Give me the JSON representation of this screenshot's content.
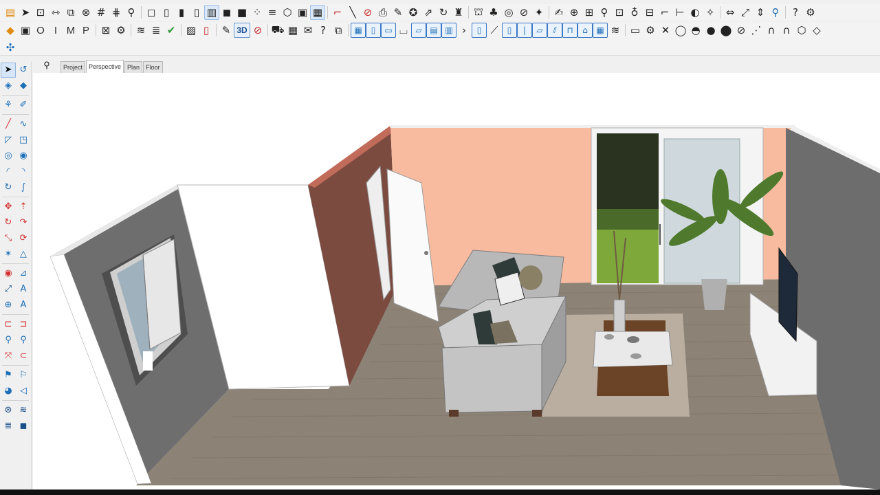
{
  "toolbar": {
    "row1": [
      {
        "name": "open-file-icon",
        "glyph": "▤",
        "cls": "orange"
      },
      {
        "name": "send-icon",
        "glyph": "➤"
      },
      {
        "name": "select-window-icon",
        "glyph": "⊡"
      },
      {
        "name": "fit-width-icon",
        "glyph": "⇿"
      },
      {
        "name": "resize-icon",
        "glyph": "⧉"
      },
      {
        "name": "link-icon",
        "glyph": "⊗"
      },
      {
        "name": "grid-icon",
        "glyph": "#"
      },
      {
        "name": "grid-off-icon",
        "glyph": "⋕"
      },
      {
        "name": "zoom-icon",
        "glyph": "⚲"
      },
      {
        "sep": true
      },
      {
        "name": "box-view-1-icon",
        "glyph": "◻"
      },
      {
        "name": "box-view-2-icon",
        "glyph": "▯"
      },
      {
        "name": "box-view-3-icon",
        "glyph": "▮"
      },
      {
        "name": "box-view-4-icon",
        "glyph": "▯"
      },
      {
        "name": "box-view-5-icon",
        "glyph": "▥",
        "cls": "active"
      },
      {
        "name": "solid-view-icon",
        "glyph": "◼"
      },
      {
        "name": "cube-icon",
        "glyph": "■"
      },
      {
        "name": "dots-icon",
        "glyph": "⁘"
      },
      {
        "name": "layers-icon",
        "glyph": "≡"
      },
      {
        "name": "hexagon-icon",
        "glyph": "⬡"
      },
      {
        "name": "frame-icon",
        "glyph": "▣"
      },
      {
        "name": "frame-active-icon",
        "glyph": "▦",
        "cls": "active"
      },
      {
        "sep": true
      },
      {
        "name": "curve-tool-icon",
        "glyph": "⌐",
        "cls": "red"
      },
      {
        "name": "pen-icon",
        "glyph": "╲"
      },
      {
        "name": "no-pen-icon",
        "glyph": "⊘",
        "cls": "red"
      },
      {
        "name": "printer-icon",
        "glyph": "⎙"
      },
      {
        "name": "brush-icon",
        "glyph": "✎"
      },
      {
        "name": "palette-icon",
        "glyph": "✪"
      },
      {
        "name": "transform-icon",
        "glyph": "⇗"
      },
      {
        "name": "rotate-icon",
        "glyph": "↻"
      },
      {
        "name": "stamp-icon",
        "glyph": "♜"
      },
      {
        "sep": true
      },
      {
        "name": "scene-icon",
        "glyph": "⛫"
      },
      {
        "name": "tree-icon",
        "glyph": "♣"
      },
      {
        "name": "target-icon",
        "glyph": "◎"
      },
      {
        "name": "no-entry-icon",
        "glyph": "⊘"
      },
      {
        "name": "magic-wand-icon",
        "glyph": "✦"
      },
      {
        "sep": true
      },
      {
        "name": "notes-icon",
        "glyph": "✍"
      },
      {
        "name": "align-icon",
        "glyph": "⊕"
      },
      {
        "name": "distribute-icon",
        "glyph": "⊞"
      },
      {
        "name": "map-pin-icon",
        "glyph": "⚲"
      },
      {
        "name": "measure-icon",
        "glyph": "⊡"
      },
      {
        "name": "lock-icon",
        "glyph": "♁"
      },
      {
        "name": "stack-icon",
        "glyph": "⊟"
      },
      {
        "name": "bracket-icon",
        "glyph": "⌐"
      },
      {
        "name": "dimension-icon",
        "glyph": "⊢"
      },
      {
        "name": "contrast-icon",
        "glyph": "◐"
      },
      {
        "name": "sparkle-icon",
        "glyph": "✧"
      },
      {
        "sep": true
      },
      {
        "name": "arrows-horizontal-icon",
        "glyph": "⇔"
      },
      {
        "name": "arrows-diagonal-icon",
        "glyph": "⤢"
      },
      {
        "name": "arrows-vertical-icon",
        "glyph": "⇕"
      },
      {
        "name": "magnifier-icon",
        "glyph": "⚲",
        "cls": "blue"
      },
      {
        "sep": true
      },
      {
        "name": "help-icon",
        "glyph": "?"
      },
      {
        "name": "settings-icon",
        "glyph": "⚙"
      }
    ],
    "row2": [
      {
        "name": "material-icon",
        "glyph": "◆",
        "cls": "orange"
      },
      {
        "name": "save-disabled-icon",
        "glyph": "▣"
      },
      {
        "name": "mode-o-button",
        "glyph": "O",
        "cls": "txt"
      },
      {
        "name": "mode-i-button",
        "glyph": "I",
        "cls": "txt"
      },
      {
        "name": "mode-m-button",
        "glyph": "M",
        "cls": "txt"
      },
      {
        "name": "mode-p-button",
        "glyph": "P",
        "cls": "txt"
      },
      {
        "sep": true
      },
      {
        "name": "export-icon",
        "glyph": "⊠"
      },
      {
        "name": "gear-icon",
        "glyph": "⚙"
      },
      {
        "sep": true
      },
      {
        "name": "layers-stack-icon",
        "glyph": "≋"
      },
      {
        "name": "hatch-icon",
        "glyph": "≣"
      },
      {
        "name": "checkmark-icon",
        "glyph": "✔",
        "cls": "green"
      },
      {
        "sep": true
      },
      {
        "name": "photo-icon",
        "glyph": "▨"
      },
      {
        "name": "pdf-icon",
        "glyph": "▯",
        "cls": "red"
      },
      {
        "sep": true
      },
      {
        "name": "edit-sheet-icon",
        "glyph": "✎"
      },
      {
        "name": "view-3d-button",
        "glyph": "3D",
        "cls": "txt3d"
      },
      {
        "name": "no-view-icon",
        "glyph": "⊘",
        "cls": "red"
      },
      {
        "sep": true
      },
      {
        "name": "cart-icon",
        "glyph": "⛟"
      },
      {
        "name": "calendar-icon",
        "glyph": "▦"
      },
      {
        "name": "mail-icon",
        "glyph": "✉"
      },
      {
        "name": "question-icon",
        "glyph": "?"
      },
      {
        "name": "screenshot-icon",
        "glyph": "⧉"
      },
      {
        "sep": true
      },
      {
        "name": "panel-1-icon",
        "glyph": "▦",
        "cls": "boxed"
      },
      {
        "name": "panel-2-icon",
        "glyph": "▯",
        "cls": "boxed"
      },
      {
        "name": "panel-3-icon",
        "glyph": "▭",
        "cls": "boxed"
      },
      {
        "name": "panel-4-icon",
        "glyph": "⌴"
      },
      {
        "name": "panel-5-icon",
        "glyph": "▱",
        "cls": "boxed"
      },
      {
        "name": "panel-6-icon",
        "glyph": "▤",
        "cls": "boxed"
      },
      {
        "name": "panel-7-icon",
        "glyph": "▥",
        "cls": "boxed"
      },
      {
        "name": "panel-8-icon",
        "glyph": "›"
      },
      {
        "name": "door-icon",
        "glyph": "▯",
        "cls": "boxed"
      },
      {
        "name": "stair-icon",
        "glyph": "⟋"
      },
      {
        "name": "pillar-icon",
        "glyph": "▯",
        "cls": "boxed"
      },
      {
        "name": "column-icon",
        "glyph": "|",
        "cls": "boxed"
      },
      {
        "name": "slab-icon",
        "glyph": "▱",
        "cls": "boxed"
      },
      {
        "name": "railing-icon",
        "glyph": "⫽",
        "cls": "boxed"
      },
      {
        "name": "opening-icon",
        "glyph": "⊓",
        "cls": "boxed"
      },
      {
        "name": "roof-icon",
        "glyph": "⌂",
        "cls": "boxed"
      },
      {
        "name": "wall-pattern-icon",
        "glyph": "▦",
        "cls": "boxed"
      },
      {
        "name": "layer-group-icon",
        "glyph": "≋"
      },
      {
        "sep": true
      },
      {
        "name": "folder-icon",
        "glyph": "▭"
      },
      {
        "name": "cog-icon",
        "glyph": "⚙"
      },
      {
        "name": "close-x-icon",
        "glyph": "✕"
      },
      {
        "name": "drop-outline-icon",
        "glyph": "◯"
      },
      {
        "name": "drop-half-icon",
        "glyph": "◓"
      },
      {
        "name": "drop-filled-icon",
        "glyph": "●"
      },
      {
        "name": "drop-dark-icon",
        "glyph": "⬤"
      },
      {
        "name": "drop-slash-icon",
        "glyph": "⊘"
      },
      {
        "name": "curve-dots-icon",
        "glyph": "⋰"
      },
      {
        "name": "magnet-1-icon",
        "glyph": "∩"
      },
      {
        "name": "magnet-2-icon",
        "glyph": "∩"
      },
      {
        "name": "shield-icon",
        "glyph": "⬡"
      },
      {
        "name": "cube-outline-icon",
        "glyph": "◇"
      }
    ],
    "row3": [
      {
        "name": "snap-icon",
        "glyph": "✣",
        "cls": "blue"
      }
    ]
  },
  "palette": [
    {
      "left": {
        "name": "select-arrow-icon",
        "glyph": "➤",
        "cls": "sel"
      },
      "right": {
        "name": "rotate-select-icon",
        "glyph": "↺"
      }
    },
    {
      "left": {
        "name": "paint-bucket-icon",
        "glyph": "◈"
      },
      "right": {
        "name": "eraser-icon",
        "glyph": "◆"
      }
    },
    {
      "sep": true
    },
    {
      "left": {
        "name": "group-icon",
        "glyph": "⚘"
      },
      "right": {
        "name": "edit-pen-icon",
        "glyph": "✐"
      }
    },
    {
      "sep": true
    },
    {
      "left": {
        "name": "line-tool-icon",
        "glyph": "╱",
        "cls": "red"
      },
      "right": {
        "name": "freehand-icon",
        "glyph": "∿"
      }
    },
    {
      "left": {
        "name": "rectangle-tool-icon",
        "glyph": "◸"
      },
      "right": {
        "name": "polygon-tool-icon",
        "glyph": "◳"
      }
    },
    {
      "left": {
        "name": "circle-tool-icon",
        "glyph": "◎"
      },
      "right": {
        "name": "circle-point-icon",
        "glyph": "◉"
      }
    },
    {
      "left": {
        "name": "arc-tool-icon",
        "glyph": "◜"
      },
      "right": {
        "name": "arc-point-icon",
        "glyph": "◝"
      }
    },
    {
      "left": {
        "name": "spiral-tool-icon",
        "glyph": "↻"
      },
      "right": {
        "name": "bezier-tool-icon",
        "glyph": "∫"
      }
    },
    {
      "sep": true
    },
    {
      "left": {
        "name": "move-tool-icon",
        "glyph": "✥",
        "cls": "red"
      },
      "right": {
        "name": "push-pull-icon",
        "glyph": "⇡",
        "cls": "red"
      }
    },
    {
      "left": {
        "name": "rotate-tool-icon",
        "glyph": "↻",
        "cls": "red"
      },
      "right": {
        "name": "offset-tool-icon",
        "glyph": "↷",
        "cls": "red"
      }
    },
    {
      "left": {
        "name": "scale-tool-icon",
        "glyph": "⤡",
        "cls": "red"
      },
      "right": {
        "name": "follow-me-icon",
        "glyph": "⟳",
        "cls": "red"
      }
    },
    {
      "left": {
        "name": "explode-icon",
        "glyph": "✶"
      },
      "right": {
        "name": "triangle-icon",
        "glyph": "△"
      }
    },
    {
      "sep": true
    },
    {
      "left": {
        "name": "tape-measure-icon",
        "glyph": "◉",
        "cls": "red"
      },
      "right": {
        "name": "protractor-icon",
        "glyph": "⊿"
      }
    },
    {
      "left": {
        "name": "dimension-tool-icon",
        "glyph": "⤢",
        "cls": "dark"
      },
      "right": {
        "name": "text-tool-icon",
        "glyph": "A"
      }
    },
    {
      "left": {
        "name": "axes-tool-icon",
        "glyph": "⊕"
      },
      "right": {
        "name": "3d-text-icon",
        "glyph": "A"
      }
    },
    {
      "sep": true
    },
    {
      "left": {
        "name": "section-plane-icon",
        "glyph": "⊏",
        "cls": "red"
      },
      "right": {
        "name": "section-cut-icon",
        "glyph": "⊐",
        "cls": "red"
      }
    },
    {
      "left": {
        "name": "zoom-tool-icon",
        "glyph": "⚲"
      },
      "right": {
        "name": "zoom-window-icon",
        "glyph": "⚲"
      }
    },
    {
      "left": {
        "name": "zoom-extents-icon",
        "glyph": "⤧",
        "cls": "red"
      },
      "right": {
        "name": "previous-view-icon",
        "glyph": "⊂",
        "cls": "red"
      }
    },
    {
      "sep": true
    },
    {
      "left": {
        "name": "position-camera-icon",
        "glyph": "⚑"
      },
      "right": {
        "name": "walk-icon",
        "glyph": "⚐"
      }
    },
    {
      "left": {
        "name": "look-around-icon",
        "glyph": "◕"
      },
      "right": {
        "name": "sound-icon",
        "glyph": "◁"
      }
    },
    {
      "sep": true
    },
    {
      "left": {
        "name": "sandbox-icon",
        "glyph": "⊛",
        "cls": "dark"
      },
      "right": {
        "name": "smoove-icon",
        "glyph": "≋",
        "cls": "dark"
      }
    },
    {
      "left": {
        "name": "layers-panel-icon",
        "glyph": "≣",
        "cls": "dark"
      },
      "right": {
        "name": "components-icon",
        "glyph": "◼",
        "cls": "dark"
      }
    }
  ],
  "tabs": [
    {
      "label": "Project",
      "active": false
    },
    {
      "label": "Perspective",
      "active": true
    },
    {
      "label": "Plan",
      "active": false
    },
    {
      "label": "Floor",
      "active": false
    }
  ],
  "search_icon": "⚲",
  "colors": {
    "floor": "#8f8579",
    "wall_gray": "#6c6c6c",
    "wall_peach": "#fbbca0",
    "wall_brown": "#7b4a40",
    "wall_white": "#ffffff",
    "rug": "#b9ada1",
    "sofa": "#c8c8c8"
  }
}
